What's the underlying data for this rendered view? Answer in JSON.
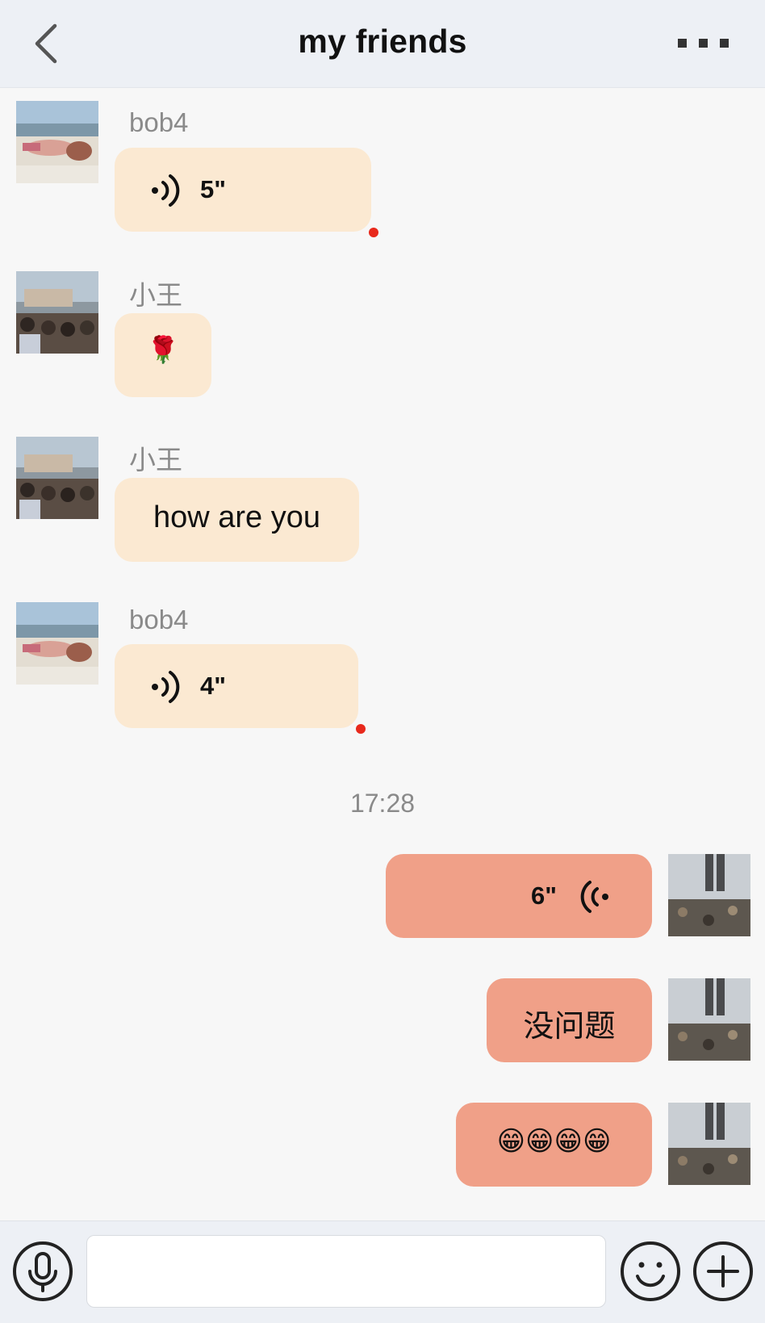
{
  "header": {
    "title": "my friends"
  },
  "messages": [
    {
      "sender": "bob4",
      "type": "voice",
      "duration": "5\"",
      "unread": true
    },
    {
      "sender": "小王",
      "type": "emoji",
      "text": "🌹"
    },
    {
      "sender": "小王",
      "type": "text",
      "text": "how are you"
    },
    {
      "sender": "bob4",
      "type": "voice",
      "duration": "4\"",
      "unread": true
    }
  ],
  "timestamp": "17:28",
  "my_messages": [
    {
      "type": "voice",
      "duration": "6\""
    },
    {
      "type": "text",
      "text": "没问题"
    },
    {
      "type": "emoji",
      "text": "😁😁😁😁"
    }
  ],
  "composer": {
    "value": ""
  },
  "colors": {
    "incoming_bubble": "#fbe9d2",
    "outgoing_bubble": "#f0a088",
    "unread_dot": "#e8291c",
    "header_bg": "#edf0f5"
  },
  "icons": {
    "back": "chevron-left-icon",
    "more": "more-dots-icon",
    "voice": "microphone-icon",
    "emoji": "smiley-icon",
    "plus": "plus-icon"
  }
}
